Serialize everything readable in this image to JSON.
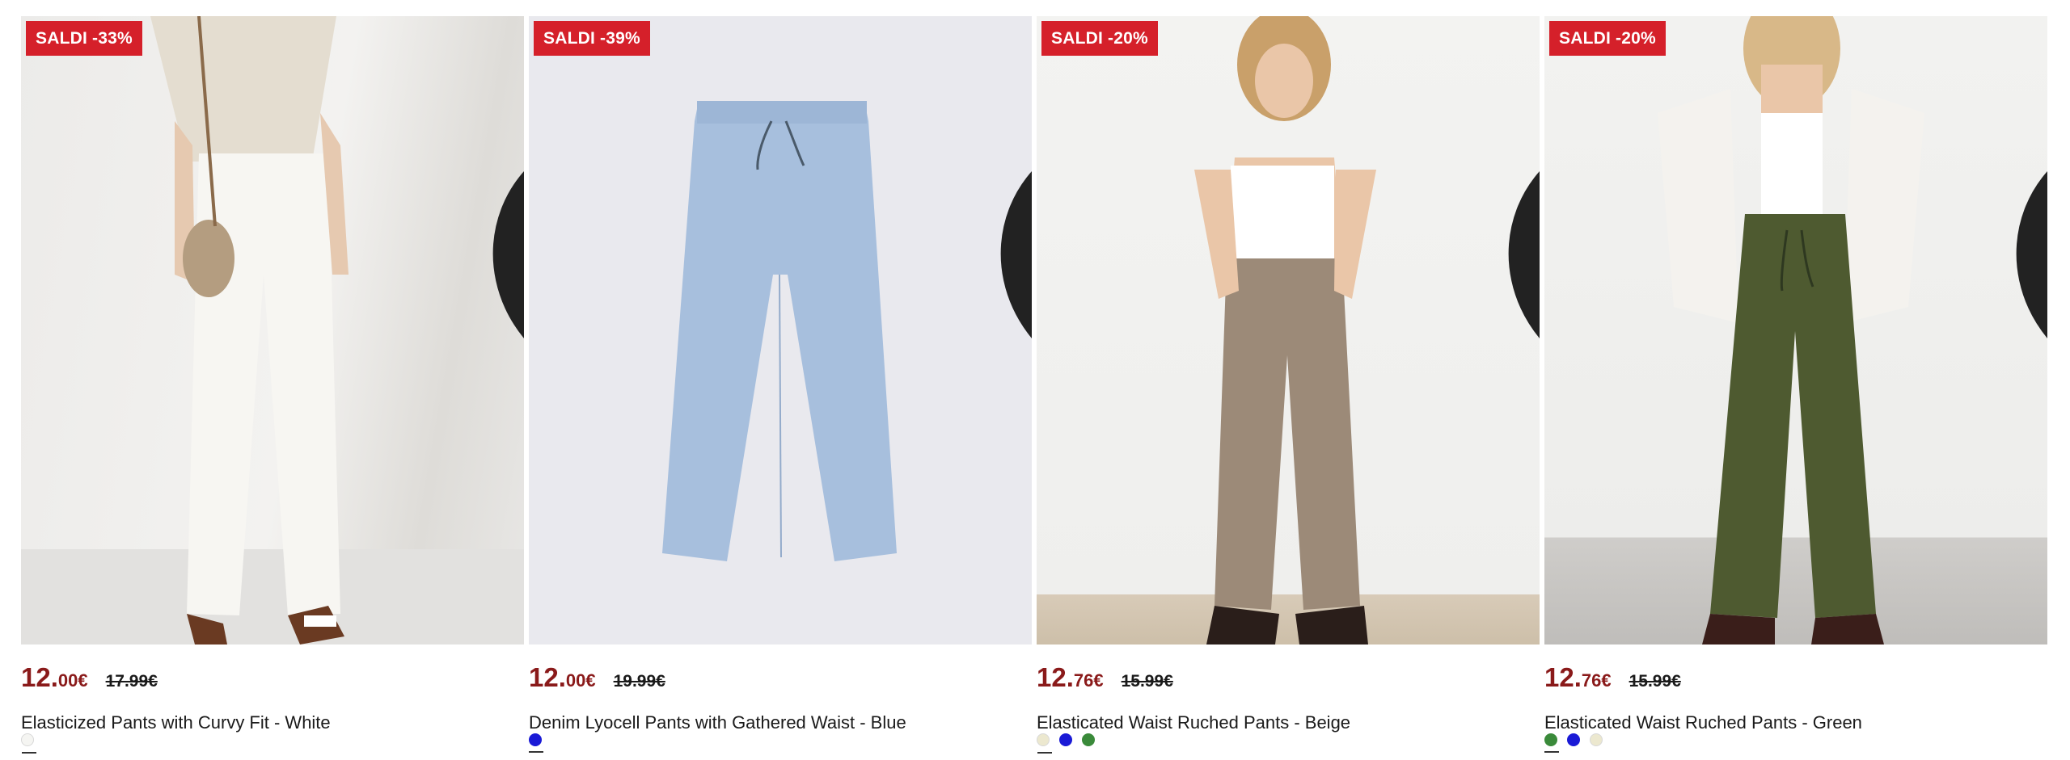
{
  "products": [
    {
      "badge": "SALDI -33%",
      "price_int": "12.",
      "price_dec": "00€",
      "price_old": "17.99€",
      "title": "Elasticized Pants with Curvy Fit - White",
      "swatches": [
        "#f5f5f2"
      ],
      "favorite_icon": "heart-outline-icon"
    },
    {
      "badge": "SALDI -39%",
      "price_int": "12.",
      "price_dec": "00€",
      "price_old": "19.99€",
      "title": "Denim Lyocell Pants with Gathered Waist - Blue",
      "swatches": [
        "#1a1ad6"
      ],
      "favorite_icon": "heart-outline-icon"
    },
    {
      "badge": "SALDI -20%",
      "price_int": "12.",
      "price_dec": "76€",
      "price_old": "15.99€",
      "title": "Elasticated Waist Ruched Pants - Beige",
      "swatches": [
        "#ece8cf",
        "#1a1ad6",
        "#3a8a3a"
      ],
      "favorite_icon": "heart-outline-icon"
    },
    {
      "badge": "SALDI -20%",
      "price_int": "12.",
      "price_dec": "76€",
      "price_old": "15.99€",
      "title": "Elasticated Waist Ruched Pants - Green",
      "swatches": [
        "#3a8a3a",
        "#1a1ad6",
        "#ece8cf"
      ],
      "favorite_icon": "heart-outline-icon"
    }
  ],
  "colors": {
    "badge_bg": "#d5202a",
    "sale_price": "#8a1a1a"
  }
}
